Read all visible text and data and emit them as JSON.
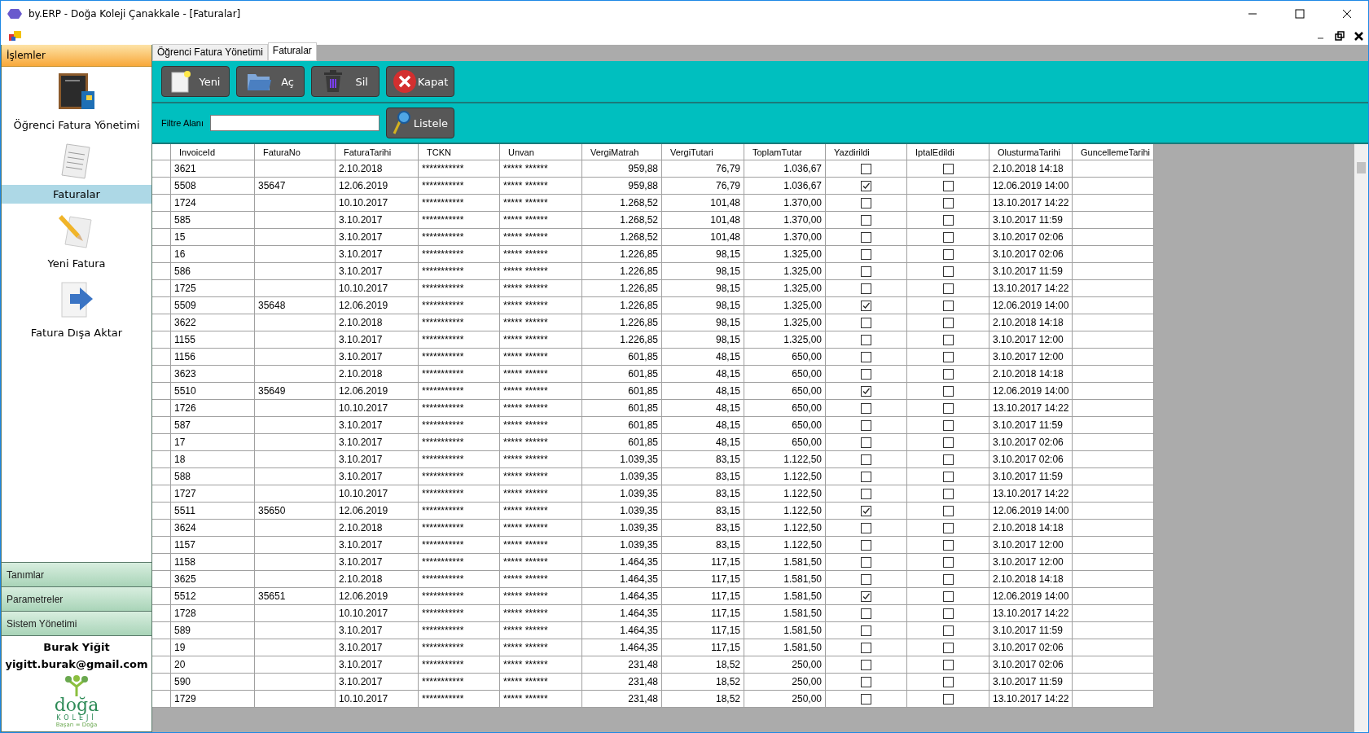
{
  "window": {
    "title": "by.ERP - Doğa Koleji Çanakkale - [Faturalar]"
  },
  "sidebar": {
    "header": "İşlemler",
    "items": [
      {
        "label": "Öğrenci Fatura Yönetimi",
        "kind": "board",
        "selected": false
      },
      {
        "label": "Faturalar",
        "kind": "invoice",
        "selected": true
      },
      {
        "label": "Yeni Fatura",
        "kind": "pencil",
        "selected": false
      },
      {
        "label": "Fatura Dışa Aktar",
        "kind": "export",
        "selected": false
      }
    ],
    "groups": [
      "Tanımlar",
      "Parametreler",
      "Sistem Yönetimi"
    ],
    "user_name": "Burak Yiğit",
    "user_email": "yigitt.burak@gmail.com",
    "logo": {
      "name": "doğa",
      "subtitle": "KOLEJİ",
      "slogan": "Başarı = Doğa"
    }
  },
  "tabs": [
    {
      "label": "Öğrenci Fatura Yönetimi",
      "selected": false
    },
    {
      "label": "Faturalar",
      "selected": true
    }
  ],
  "toolbar": [
    {
      "label": "Yeni",
      "kind": "new"
    },
    {
      "label": "Aç",
      "kind": "open"
    },
    {
      "label": "Sil",
      "kind": "delete"
    },
    {
      "label": "Kapat",
      "kind": "close"
    }
  ],
  "filter": {
    "label": "Filtre Alanı",
    "button": "Listele"
  },
  "table": {
    "columns": [
      "InvoiceId",
      "FaturaNo",
      "FaturaTarihi",
      "TCKN",
      "Unvan",
      "VergiMatrah",
      "VergiTutari",
      "ToplamTutar",
      "Yazdirildi",
      "IptalEdildi",
      "OlusturmaTarihi",
      "GuncellemeTarihi"
    ],
    "rows": [
      {
        "invoice_id": "3621",
        "fatura_tarihi": "2.10.2018",
        "tckn": "***********",
        "unvan": "***** ******",
        "vergi_matrah": "959,88",
        "vergi_tutari": "76,79",
        "toplam_tutar": "1.036,67",
        "yazdirildi": false,
        "iptal_edildi": false,
        "olusturma_tarihi": "2.10.2018 14:18"
      },
      {
        "invoice_id": "5508",
        "fatura_no": "35647",
        "fatura_tarihi": "12.06.2019",
        "tckn": "***********",
        "unvan": "***** ******",
        "vergi_matrah": "959,88",
        "vergi_tutari": "76,79",
        "toplam_tutar": "1.036,67",
        "yazdirildi": true,
        "iptal_edildi": false,
        "olusturma_tarihi": "12.06.2019 14:00"
      },
      {
        "invoice_id": "1724",
        "fatura_tarihi": "10.10.2017",
        "tckn": "***********",
        "unvan": "***** ******",
        "vergi_matrah": "1.268,52",
        "vergi_tutari": "101,48",
        "toplam_tutar": "1.370,00",
        "yazdirildi": false,
        "iptal_edildi": false,
        "olusturma_tarihi": "13.10.2017 14:22"
      },
      {
        "invoice_id": "585",
        "fatura_tarihi": "3.10.2017",
        "tckn": "***********",
        "unvan": "***** ******",
        "vergi_matrah": "1.268,52",
        "vergi_tutari": "101,48",
        "toplam_tutar": "1.370,00",
        "yazdirildi": false,
        "iptal_edildi": false,
        "olusturma_tarihi": "3.10.2017 11:59"
      },
      {
        "invoice_id": "15",
        "fatura_tarihi": "3.10.2017",
        "tckn": "***********",
        "unvan": "***** ******",
        "vergi_matrah": "1.268,52",
        "vergi_tutari": "101,48",
        "toplam_tutar": "1.370,00",
        "yazdirildi": false,
        "iptal_edildi": false,
        "olusturma_tarihi": "3.10.2017 02:06"
      },
      {
        "invoice_id": "16",
        "fatura_tarihi": "3.10.2017",
        "tckn": "***********",
        "unvan": "***** ******",
        "vergi_matrah": "1.226,85",
        "vergi_tutari": "98,15",
        "toplam_tutar": "1.325,00",
        "yazdirildi": false,
        "iptal_edildi": false,
        "olusturma_tarihi": "3.10.2017 02:06"
      },
      {
        "invoice_id": "586",
        "fatura_tarihi": "3.10.2017",
        "tckn": "***********",
        "unvan": "***** ******",
        "vergi_matrah": "1.226,85",
        "vergi_tutari": "98,15",
        "toplam_tutar": "1.325,00",
        "yazdirildi": false,
        "iptal_edildi": false,
        "olusturma_tarihi": "3.10.2017 11:59"
      },
      {
        "invoice_id": "1725",
        "fatura_tarihi": "10.10.2017",
        "tckn": "***********",
        "unvan": "***** ******",
        "vergi_matrah": "1.226,85",
        "vergi_tutari": "98,15",
        "toplam_tutar": "1.325,00",
        "yazdirildi": false,
        "iptal_edildi": false,
        "olusturma_tarihi": "13.10.2017 14:22"
      },
      {
        "invoice_id": "5509",
        "fatura_no": "35648",
        "fatura_tarihi": "12.06.2019",
        "tckn": "***********",
        "unvan": "***** ******",
        "vergi_matrah": "1.226,85",
        "vergi_tutari": "98,15",
        "toplam_tutar": "1.325,00",
        "yazdirildi": true,
        "iptal_edildi": false,
        "olusturma_tarihi": "12.06.2019 14:00"
      },
      {
        "invoice_id": "3622",
        "fatura_tarihi": "2.10.2018",
        "tckn": "***********",
        "unvan": "***** ******",
        "vergi_matrah": "1.226,85",
        "vergi_tutari": "98,15",
        "toplam_tutar": "1.325,00",
        "yazdirildi": false,
        "iptal_edildi": false,
        "olusturma_tarihi": "2.10.2018 14:18"
      },
      {
        "invoice_id": "1155",
        "fatura_tarihi": "3.10.2017",
        "tckn": "***********",
        "unvan": "***** ******",
        "vergi_matrah": "1.226,85",
        "vergi_tutari": "98,15",
        "toplam_tutar": "1.325,00",
        "yazdirildi": false,
        "iptal_edildi": false,
        "olusturma_tarihi": "3.10.2017 12:00"
      },
      {
        "invoice_id": "1156",
        "fatura_tarihi": "3.10.2017",
        "tckn": "***********",
        "unvan": "***** ******",
        "vergi_matrah": "601,85",
        "vergi_tutari": "48,15",
        "toplam_tutar": "650,00",
        "yazdirildi": false,
        "iptal_edildi": false,
        "olusturma_tarihi": "3.10.2017 12:00"
      },
      {
        "invoice_id": "3623",
        "fatura_tarihi": "2.10.2018",
        "tckn": "***********",
        "unvan": "***** ******",
        "vergi_matrah": "601,85",
        "vergi_tutari": "48,15",
        "toplam_tutar": "650,00",
        "yazdirildi": false,
        "iptal_edildi": false,
        "olusturma_tarihi": "2.10.2018 14:18"
      },
      {
        "invoice_id": "5510",
        "fatura_no": "35649",
        "fatura_tarihi": "12.06.2019",
        "tckn": "***********",
        "unvan": "***** ******",
        "vergi_matrah": "601,85",
        "vergi_tutari": "48,15",
        "toplam_tutar": "650,00",
        "yazdirildi": true,
        "iptal_edildi": false,
        "olusturma_tarihi": "12.06.2019 14:00"
      },
      {
        "invoice_id": "1726",
        "fatura_tarihi": "10.10.2017",
        "tckn": "***********",
        "unvan": "***** ******",
        "vergi_matrah": "601,85",
        "vergi_tutari": "48,15",
        "toplam_tutar": "650,00",
        "yazdirildi": false,
        "iptal_edildi": false,
        "olusturma_tarihi": "13.10.2017 14:22"
      },
      {
        "invoice_id": "587",
        "fatura_tarihi": "3.10.2017",
        "tckn": "***********",
        "unvan": "***** ******",
        "vergi_matrah": "601,85",
        "vergi_tutari": "48,15",
        "toplam_tutar": "650,00",
        "yazdirildi": false,
        "iptal_edildi": false,
        "olusturma_tarihi": "3.10.2017 11:59"
      },
      {
        "invoice_id": "17",
        "fatura_tarihi": "3.10.2017",
        "tckn": "***********",
        "unvan": "***** ******",
        "vergi_matrah": "601,85",
        "vergi_tutari": "48,15",
        "toplam_tutar": "650,00",
        "yazdirildi": false,
        "iptal_edildi": false,
        "olusturma_tarihi": "3.10.2017 02:06"
      },
      {
        "invoice_id": "18",
        "fatura_tarihi": "3.10.2017",
        "tckn": "***********",
        "unvan": "***** ******",
        "vergi_matrah": "1.039,35",
        "vergi_tutari": "83,15",
        "toplam_tutar": "1.122,50",
        "yazdirildi": false,
        "iptal_edildi": false,
        "olusturma_tarihi": "3.10.2017 02:06"
      },
      {
        "invoice_id": "588",
        "fatura_tarihi": "3.10.2017",
        "tckn": "***********",
        "unvan": "***** ******",
        "vergi_matrah": "1.039,35",
        "vergi_tutari": "83,15",
        "toplam_tutar": "1.122,50",
        "yazdirildi": false,
        "iptal_edildi": false,
        "olusturma_tarihi": "3.10.2017 11:59"
      },
      {
        "invoice_id": "1727",
        "fatura_tarihi": "10.10.2017",
        "tckn": "***********",
        "unvan": "***** ******",
        "vergi_matrah": "1.039,35",
        "vergi_tutari": "83,15",
        "toplam_tutar": "1.122,50",
        "yazdirildi": false,
        "iptal_edildi": false,
        "olusturma_tarihi": "13.10.2017 14:22"
      },
      {
        "invoice_id": "5511",
        "fatura_no": "35650",
        "fatura_tarihi": "12.06.2019",
        "tckn": "***********",
        "unvan": "***** ******",
        "vergi_matrah": "1.039,35",
        "vergi_tutari": "83,15",
        "toplam_tutar": "1.122,50",
        "yazdirildi": true,
        "iptal_edildi": false,
        "olusturma_tarihi": "12.06.2019 14:00"
      },
      {
        "invoice_id": "3624",
        "fatura_tarihi": "2.10.2018",
        "tckn": "***********",
        "unvan": "***** ******",
        "vergi_matrah": "1.039,35",
        "vergi_tutari": "83,15",
        "toplam_tutar": "1.122,50",
        "yazdirildi": false,
        "iptal_edildi": false,
        "olusturma_tarihi": "2.10.2018 14:18"
      },
      {
        "invoice_id": "1157",
        "fatura_tarihi": "3.10.2017",
        "tckn": "***********",
        "unvan": "***** ******",
        "vergi_matrah": "1.039,35",
        "vergi_tutari": "83,15",
        "toplam_tutar": "1.122,50",
        "yazdirildi": false,
        "iptal_edildi": false,
        "olusturma_tarihi": "3.10.2017 12:00"
      },
      {
        "invoice_id": "1158",
        "fatura_tarihi": "3.10.2017",
        "tckn": "***********",
        "unvan": "***** ******",
        "vergi_matrah": "1.464,35",
        "vergi_tutari": "117,15",
        "toplam_tutar": "1.581,50",
        "yazdirildi": false,
        "iptal_edildi": false,
        "olusturma_tarihi": "3.10.2017 12:00"
      },
      {
        "invoice_id": "3625",
        "fatura_tarihi": "2.10.2018",
        "tckn": "***********",
        "unvan": "***** ******",
        "vergi_matrah": "1.464,35",
        "vergi_tutari": "117,15",
        "toplam_tutar": "1.581,50",
        "yazdirildi": false,
        "iptal_edildi": false,
        "olusturma_tarihi": "2.10.2018 14:18"
      },
      {
        "invoice_id": "5512",
        "fatura_no": "35651",
        "fatura_tarihi": "12.06.2019",
        "tckn": "***********",
        "unvan": "***** ******",
        "vergi_matrah": "1.464,35",
        "vergi_tutari": "117,15",
        "toplam_tutar": "1.581,50",
        "yazdirildi": true,
        "iptal_edildi": false,
        "olusturma_tarihi": "12.06.2019 14:00"
      },
      {
        "invoice_id": "1728",
        "fatura_tarihi": "10.10.2017",
        "tckn": "***********",
        "unvan": "***** ******",
        "vergi_matrah": "1.464,35",
        "vergi_tutari": "117,15",
        "toplam_tutar": "1.581,50",
        "yazdirildi": false,
        "iptal_edildi": false,
        "olusturma_tarihi": "13.10.2017 14:22"
      },
      {
        "invoice_id": "589",
        "fatura_tarihi": "3.10.2017",
        "tckn": "***********",
        "unvan": "***** ******",
        "vergi_matrah": "1.464,35",
        "vergi_tutari": "117,15",
        "toplam_tutar": "1.581,50",
        "yazdirildi": false,
        "iptal_edildi": false,
        "olusturma_tarihi": "3.10.2017 11:59"
      },
      {
        "invoice_id": "19",
        "fatura_tarihi": "3.10.2017",
        "tckn": "***********",
        "unvan": "***** ******",
        "vergi_matrah": "1.464,35",
        "vergi_tutari": "117,15",
        "toplam_tutar": "1.581,50",
        "yazdirildi": false,
        "iptal_edildi": false,
        "olusturma_tarihi": "3.10.2017 02:06"
      },
      {
        "invoice_id": "20",
        "fatura_tarihi": "3.10.2017",
        "tckn": "***********",
        "unvan": "***** ******",
        "vergi_matrah": "231,48",
        "vergi_tutari": "18,52",
        "toplam_tutar": "250,00",
        "yazdirildi": false,
        "iptal_edildi": false,
        "olusturma_tarihi": "3.10.2017 02:06"
      },
      {
        "invoice_id": "590",
        "fatura_tarihi": "3.10.2017",
        "tckn": "***********",
        "unvan": "***** ******",
        "vergi_matrah": "231,48",
        "vergi_tutari": "18,52",
        "toplam_tutar": "250,00",
        "yazdirildi": false,
        "iptal_edildi": false,
        "olusturma_tarihi": "3.10.2017 11:59"
      },
      {
        "invoice_id": "1729",
        "fatura_tarihi": "10.10.2017",
        "tckn": "***********",
        "unvan": "***** ******",
        "vergi_matrah": "231,48",
        "vergi_tutari": "18,52",
        "toplam_tutar": "250,00",
        "yazdirildi": false,
        "iptal_edildi": false,
        "olusturma_tarihi": "13.10.2017 14:22"
      }
    ]
  }
}
